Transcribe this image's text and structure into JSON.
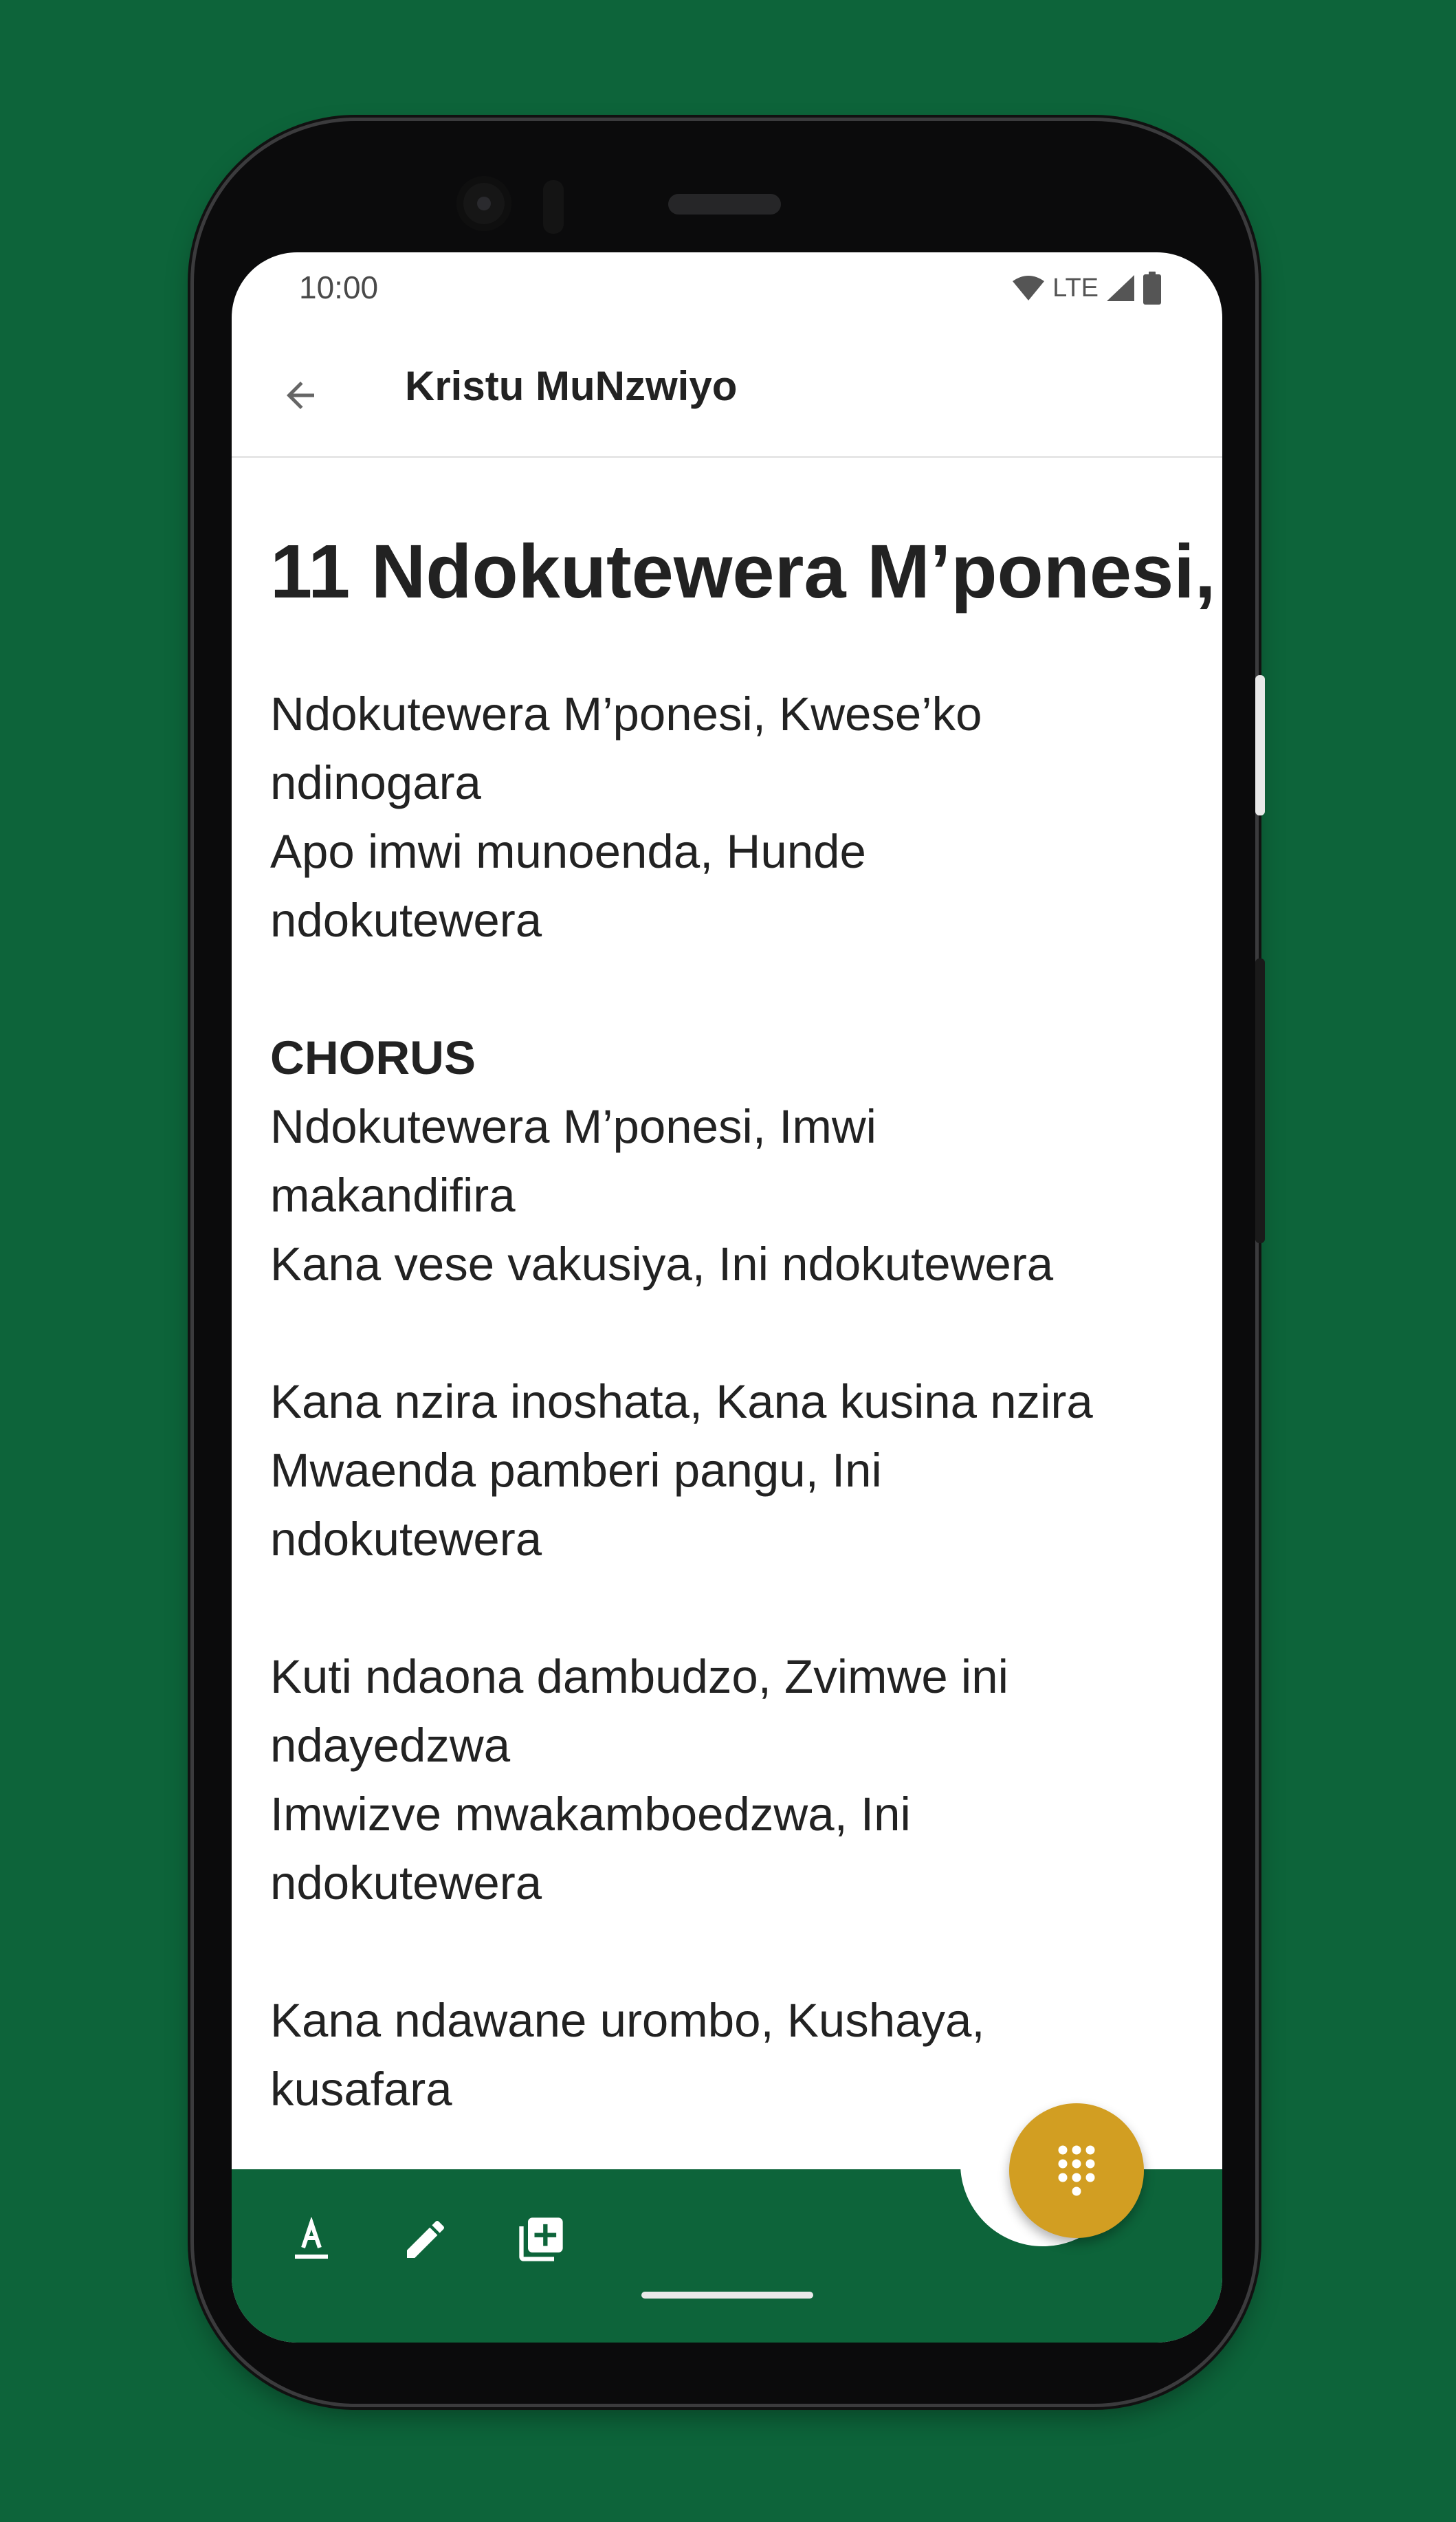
{
  "status_bar": {
    "time": "10:00",
    "network": "LTE"
  },
  "app_bar": {
    "title": "Kristu MuNzwiyo",
    "back_icon": "arrow-back-icon"
  },
  "hymn": {
    "title": "11 Ndokutewera M’ponesi,",
    "stanzas": [
      {
        "lines": [
          "Ndokutewera M’ponesi, Kwese’ko",
          "ndinogara",
          "Apo imwi munoenda, Hunde",
          "ndokutewera"
        ]
      },
      {
        "label": "CHORUS",
        "lines": [
          "Ndokutewera M’ponesi, Imwi",
          "makandifira",
          "Kana vese vakusiya, Ini ndokutewera"
        ]
      },
      {
        "lines": [
          "Kana nzira inoshata, Kana kusina nzira",
          "Mwaenda pamberi pangu, Ini",
          "ndokutewera"
        ]
      },
      {
        "lines": [
          "Kuti ndaona dambudzo, Zvimwe ini",
          "ndayedzwa",
          "Imwizve mwakamboedzwa, Ini",
          "ndokutewera"
        ]
      },
      {
        "lines": [
          "Kana ndawane urombo, Kushaya,",
          "kusafara"
        ]
      }
    ]
  },
  "bottom_bar": {
    "tools": [
      {
        "name": "text-format-icon"
      },
      {
        "name": "edit-pencil-icon"
      },
      {
        "name": "add-to-library-icon"
      }
    ],
    "fab_icon": "dialpad-icon"
  },
  "colors": {
    "brand_green": "#0d643a",
    "fab_gold": "#d29e22"
  }
}
